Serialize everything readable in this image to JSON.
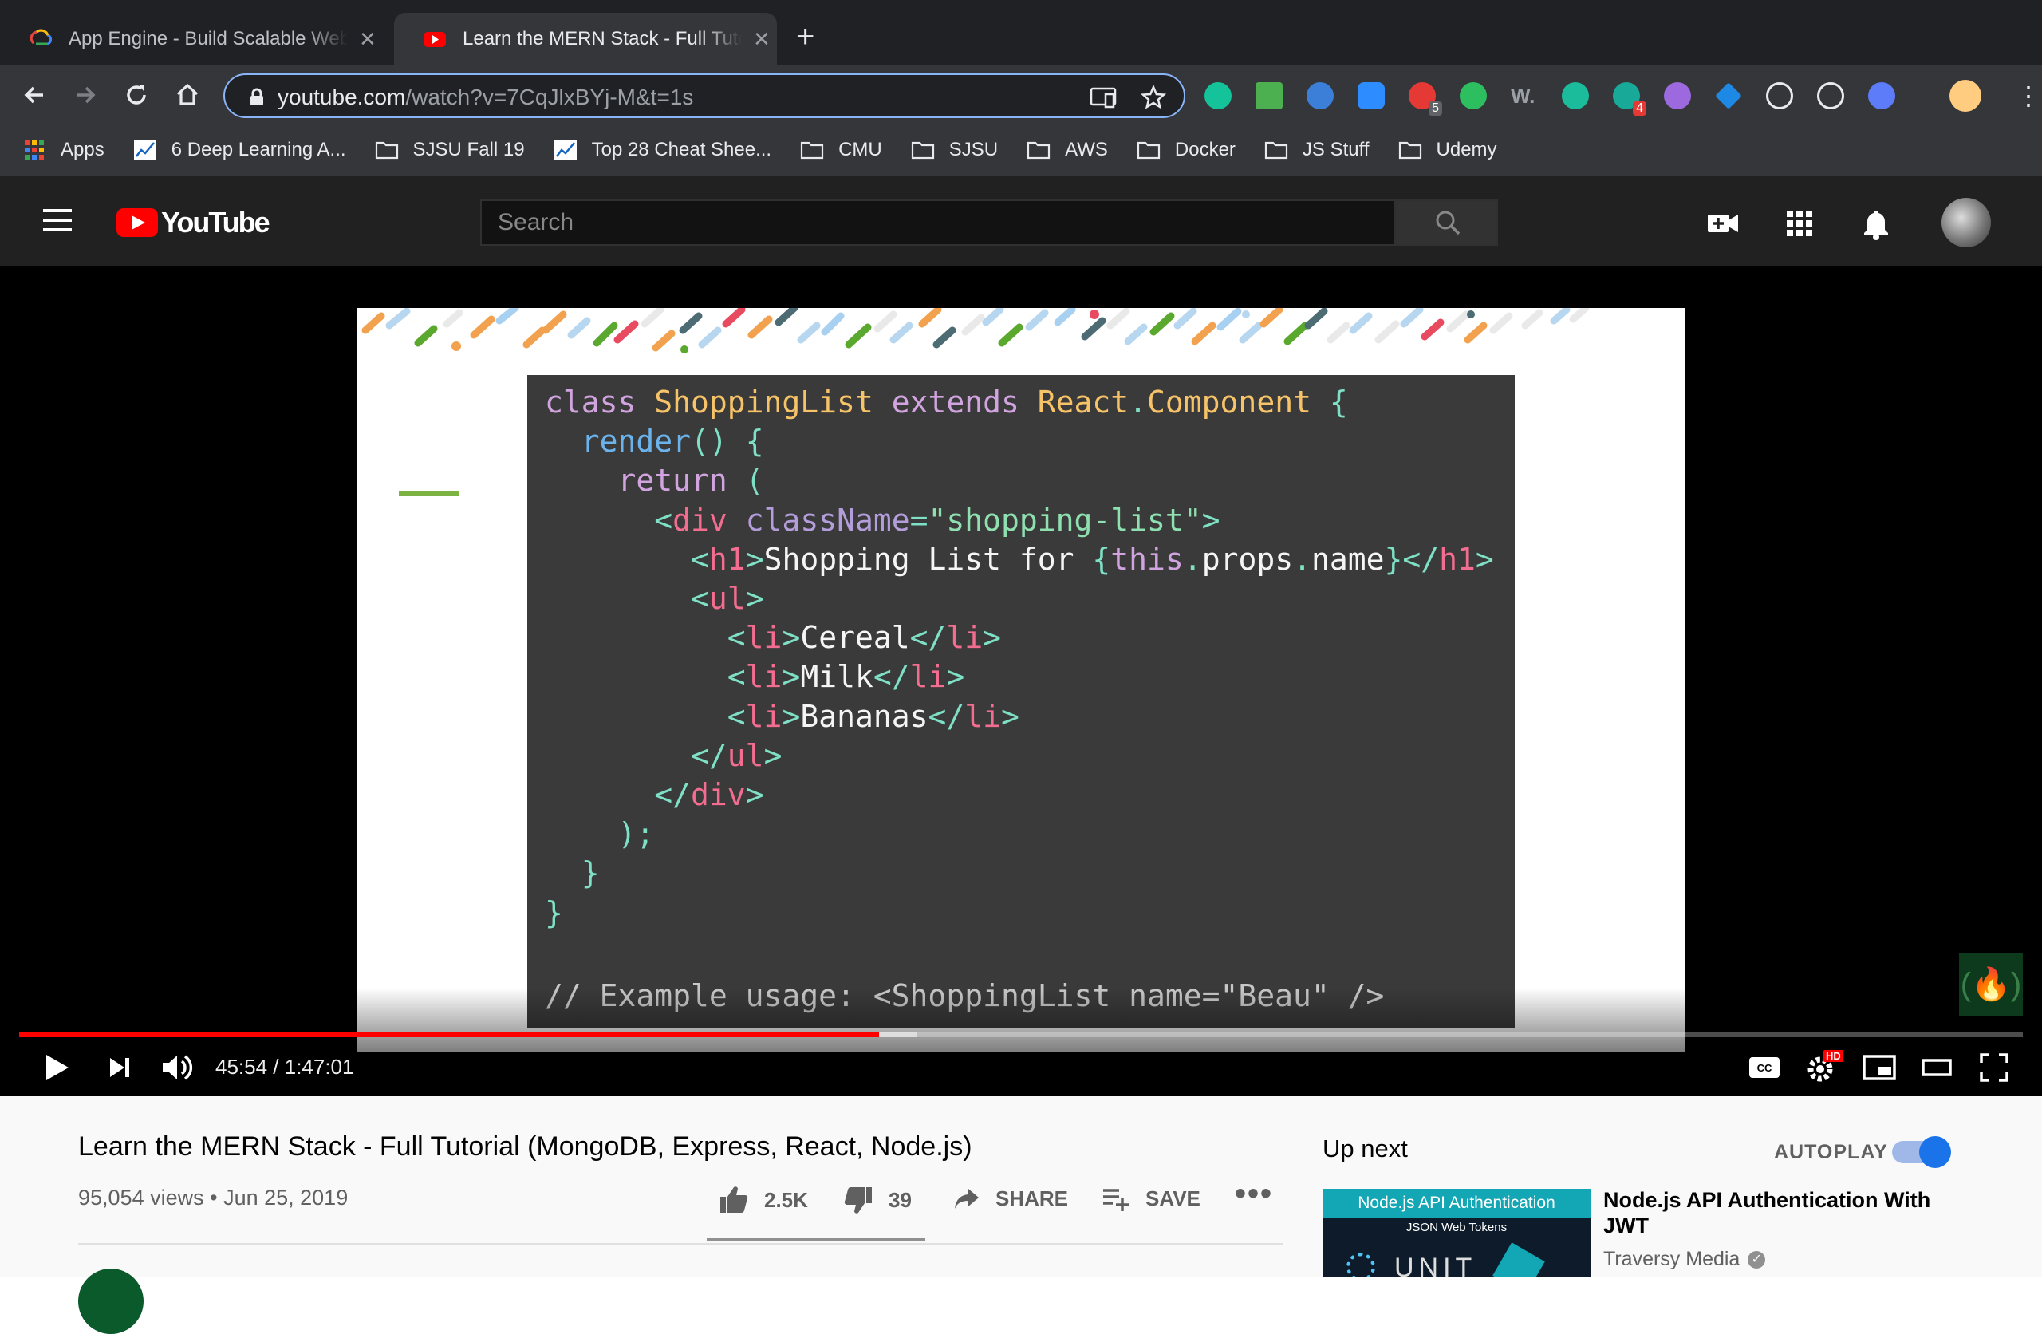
{
  "browser": {
    "tabs": [
      {
        "title": "App Engine - Build Scalable Web",
        "icon": "google-cloud-icon"
      },
      {
        "title": "Learn the MERN Stack - Full Tutorial",
        "icon": "youtube-icon"
      }
    ],
    "new_tab_icon": "plus-icon",
    "url_host": "youtube.com",
    "url_path": "/watch?v=7CqJlxBYj-M&t=1s",
    "bookmarks": [
      {
        "label": "Apps",
        "icon": "apps-grid-icon"
      },
      {
        "label": "6 Deep Learning A...",
        "icon": "chart-icon"
      },
      {
        "label": "SJSU Fall 19",
        "icon": "folder-icon"
      },
      {
        "label": "Top 28 Cheat Shee...",
        "icon": "chart-icon"
      },
      {
        "label": "CMU",
        "icon": "folder-icon"
      },
      {
        "label": "SJSU",
        "icon": "folder-icon"
      },
      {
        "label": "AWS",
        "icon": "folder-icon"
      },
      {
        "label": "Docker",
        "icon": "folder-icon"
      },
      {
        "label": "JS Stuff",
        "icon": "folder-icon"
      },
      {
        "label": "Udemy",
        "icon": "folder-icon"
      }
    ],
    "extension_badges": {
      "first": "5",
      "second": "4"
    }
  },
  "youtube": {
    "logo_text": "YouTube",
    "search_placeholder": "Search"
  },
  "slide": {
    "code_lines": [
      "class ShoppingList extends React.Component {",
      "  render() {",
      "    return (",
      "      <div className=\"shopping-list\">",
      "        <h1>Shopping List for {this.props.name}</h1>",
      "        <ul>",
      "          <li>Cereal</li>",
      "          <li>Milk</li>",
      "          <li>Bananas</li>",
      "        </ul>",
      "      </div>",
      "    );",
      "  }",
      "}",
      "",
      "// Example usage: <ShoppingList name=\"Beau\" />"
    ]
  },
  "player": {
    "current_time": "45:54",
    "duration": "1:47:01",
    "time_display": "45:54 / 1:47:01",
    "played_fraction": 0.429,
    "buffered_fraction": 0.448,
    "hd_badge": "HD"
  },
  "video": {
    "title": "Learn the MERN Stack - Full Tutorial (MongoDB, Express, React, Node.js)",
    "views": "95,054 views",
    "date": "Jun 25, 2019",
    "likes": "2.5K",
    "dislikes": "39",
    "share_label": "SHARE",
    "save_label": "SAVE"
  },
  "sidebar": {
    "up_next_label": "Up next",
    "autoplay_label": "AUTOPLAY",
    "autoplay_on": true,
    "recommendations": [
      {
        "title": "Node.js API Authentication With JWT",
        "channel": "Traversy Media",
        "thumb_title": "Node.js API Authentication",
        "thumb_subtitle": "JSON Web Tokens",
        "thumb_big": "UNIT"
      }
    ]
  }
}
